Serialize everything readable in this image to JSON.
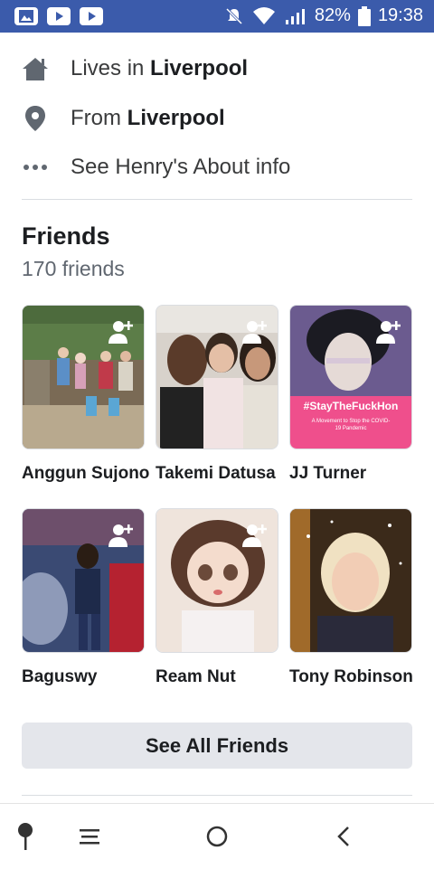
{
  "status_bar": {
    "icons": [
      "image-app-icon",
      "youtube-app-icon",
      "youtube-app-icon"
    ],
    "battery": "82%",
    "time": "19:38"
  },
  "about": {
    "lives_prefix": "Lives in ",
    "lives_city": "Liverpool",
    "from_prefix": "From ",
    "from_city": "Liverpool",
    "see_about": "See Henry's About info"
  },
  "friends": {
    "title": "Friends",
    "count": "170 friends",
    "items": [
      {
        "name": "Anggun Sujono"
      },
      {
        "name": "Takemi Datusa"
      },
      {
        "name": "JJ Turner"
      },
      {
        "name": "Baguswy"
      },
      {
        "name": "Ream Nut"
      },
      {
        "name": "Tony Robinson"
      }
    ],
    "jj_banner_text": "#StayTheFuckHon",
    "jj_banner_sub": "A Movement to Stop the COVID-19 Pandemic",
    "see_all": "See All Friends"
  },
  "colors": {
    "status_bar": "#3b5bab",
    "button_bg": "#e4e6eb"
  }
}
